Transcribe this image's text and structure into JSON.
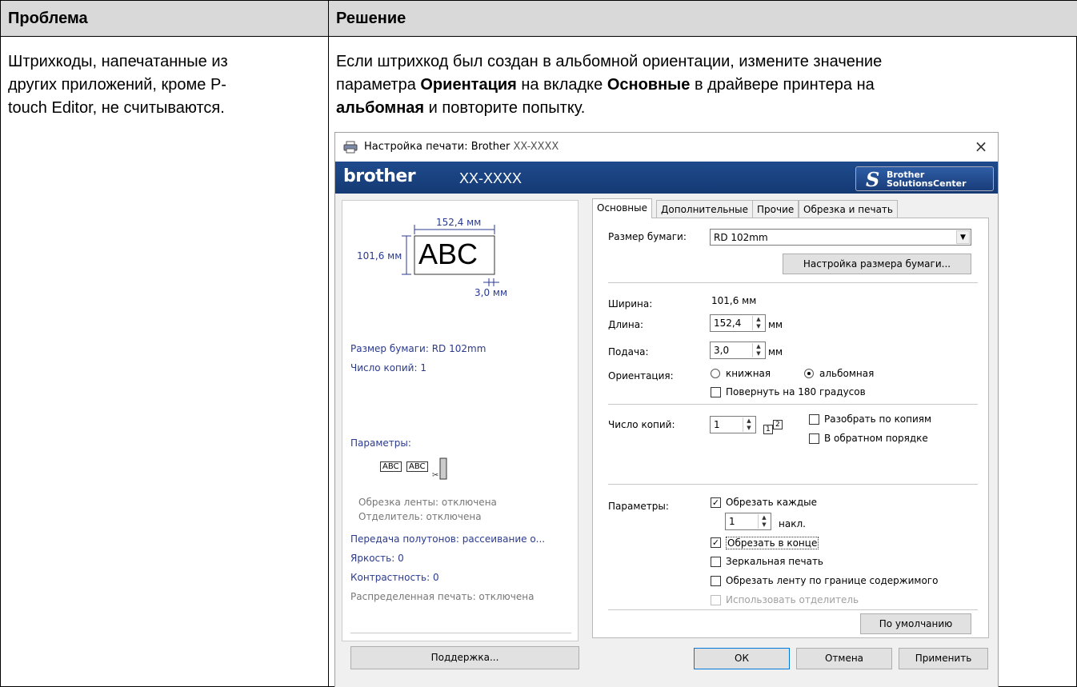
{
  "table": {
    "header_problem": "Проблема",
    "header_solution": "Решение",
    "problem_lines": [
      "Штрихкоды, напечатанные из",
      "других приложений, кроме P-",
      "touch Editor, не считываются."
    ],
    "solution": {
      "l1": "Если штрихкод был создан в альбомной ориентации, измените значение",
      "l2_a": "параметра ",
      "l2_b": "Ориентация",
      "l2_c": " на вкладке ",
      "l2_d": "Основные",
      "l2_e": " в драйвере принтера на",
      "l3_a": "альбомная",
      "l3_b": " и повторите попытку."
    }
  },
  "dialog": {
    "title": "Настройка печати: Brother",
    "title_model": "XX-XXXX",
    "close": "×",
    "brand": "brother",
    "model": "XX-XXXX",
    "solutions_center": {
      "line1": "Brother",
      "line2": "SolutionsCenter"
    },
    "preview": {
      "width_dim": "152,4 мм",
      "height_dim": "101,6 мм",
      "gap_dim": "3,0 мм",
      "sample": "ABC",
      "paper_size": "Размер бумаги: RD 102mm",
      "copies": "Число копий: 1",
      "params_heading": "Параметры:",
      "thumb1": "ABC",
      "thumb2": "ABC",
      "cut_tape": "Обрезка ленты: отключена",
      "separator": "Отделитель: отключена",
      "halftone": "Передача полутонов: рассеивание о...",
      "brightness": "Яркость:  0",
      "contrast": "Контрастность:  0",
      "distributed": "Распределенная печать: отключена",
      "support_button": "Поддержка..."
    },
    "tabs": [
      "Основные",
      "Дополнительные",
      "Прочие",
      "Обрезка и печать"
    ],
    "basic": {
      "paper_size_label": "Размер бумаги:",
      "paper_size_value": "RD 102mm",
      "paper_size_setup": "Настройка размера бумаги...",
      "width_label": "Ширина:",
      "width_value": "101,6 мм",
      "length_label": "Длина:",
      "length_value": "152,4",
      "length_unit": "мм",
      "feed_label": "Подача:",
      "feed_value": "3,0",
      "feed_unit": "мм",
      "orientation_label": "Ориентация:",
      "portrait": "книжная",
      "landscape": "альбомная",
      "rotate180": "Повернуть на 180 градусов",
      "copies_label": "Число копий:",
      "copies_value": "1",
      "collate_icon_a": "1",
      "collate_icon_b": "2",
      "collate": "Разобрать по копиям",
      "reverse": "В обратном порядке",
      "options_label": "Параметры:",
      "cut_every": "Обрезать каждые",
      "cut_every_value": "1",
      "cut_every_unit": "накл.",
      "cut_at_end": "Обрезать в конце",
      "mirror": "Зеркальная печать",
      "trim_tape": "Обрезать ленту по границе содержимого",
      "use_separator": "Использовать отделитель",
      "defaults_button": "По умолчанию"
    },
    "footer": {
      "ok": "ОК",
      "cancel": "Отмена",
      "apply": "Применить"
    },
    "colors": {
      "brandbar": "#1e4a8c",
      "preview_text": "#2a3a8f"
    }
  }
}
